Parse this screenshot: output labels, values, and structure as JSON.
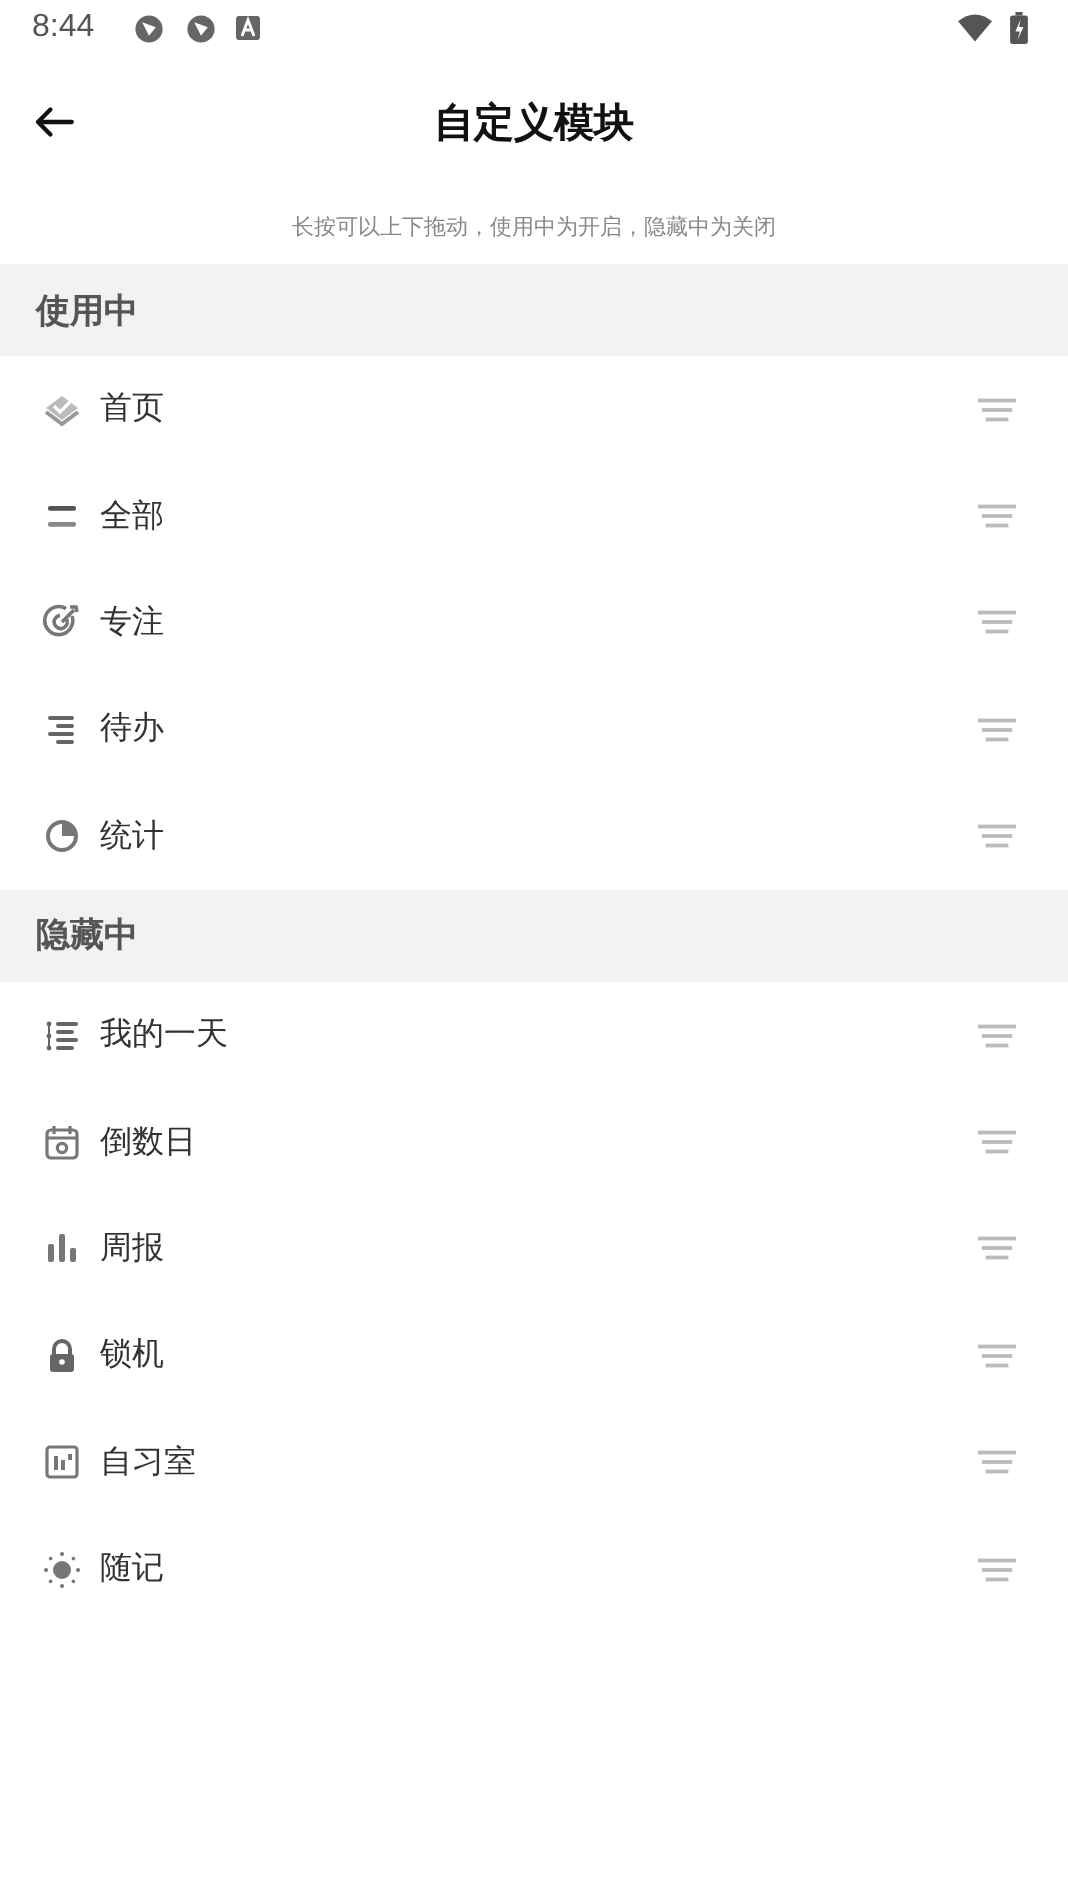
{
  "status_bar": {
    "time": "8:44"
  },
  "header": {
    "title": "自定义模块"
  },
  "hint": "长按可以上下拖动，使用中为开启，隐藏中为关闭",
  "sections": [
    {
      "title": "使用中",
      "items": [
        {
          "label": "首页",
          "kind": "layers"
        },
        {
          "label": "全部",
          "kind": "lines"
        },
        {
          "label": "专注",
          "kind": "target"
        },
        {
          "label": "待办",
          "kind": "todo"
        },
        {
          "label": "统计",
          "kind": "pie"
        }
      ]
    },
    {
      "title": "隐藏中",
      "items": [
        {
          "label": "我的一天",
          "kind": "list"
        },
        {
          "label": "倒数日",
          "kind": "calendar"
        },
        {
          "label": "周报",
          "kind": "bars"
        },
        {
          "label": "锁机",
          "kind": "lock"
        },
        {
          "label": "自习室",
          "kind": "room"
        },
        {
          "label": "随记",
          "kind": "sun"
        }
      ]
    }
  ]
}
